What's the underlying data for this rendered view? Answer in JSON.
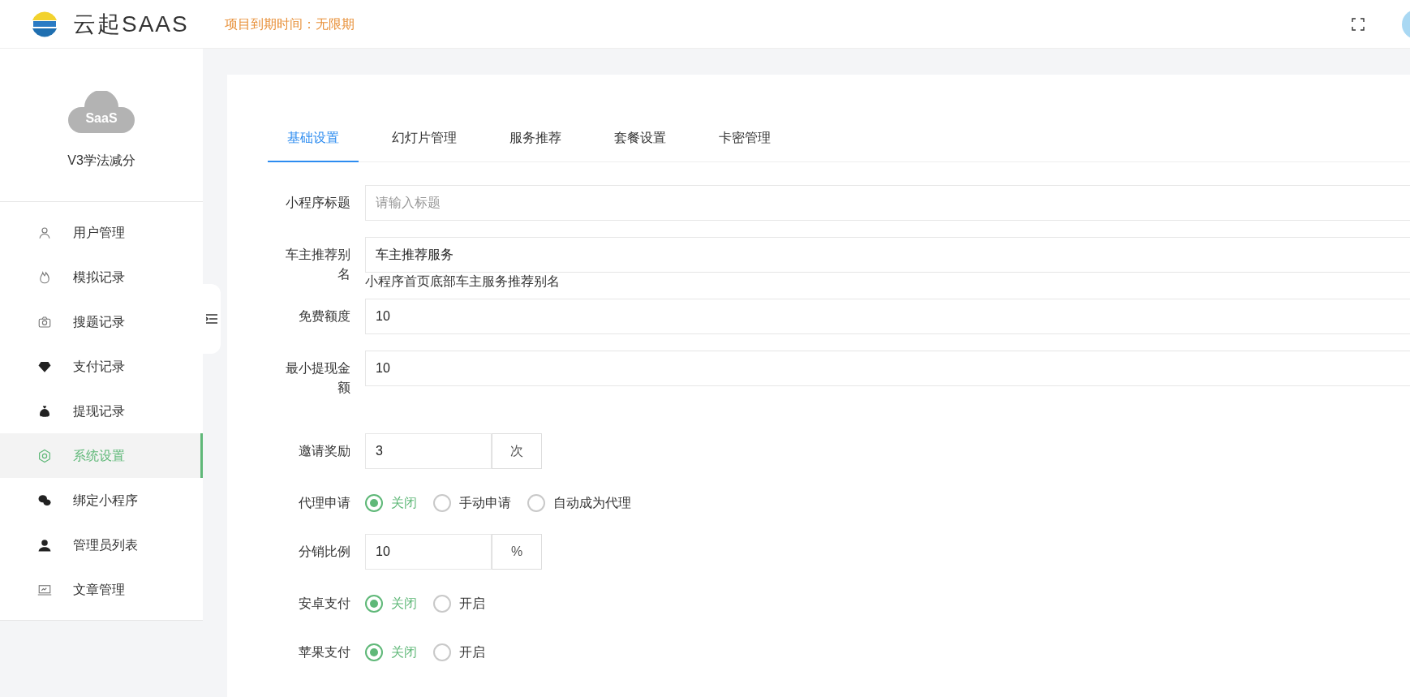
{
  "header": {
    "title": "云起SAAS",
    "expiry": "项目到期时间：无限期"
  },
  "sidebar": {
    "cloud_text": "SaaS",
    "app_name": "V3学法减分",
    "items": [
      {
        "label": "用户管理",
        "selected": false
      },
      {
        "label": "模拟记录",
        "selected": false
      },
      {
        "label": "搜题记录",
        "selected": false
      },
      {
        "label": "支付记录",
        "selected": false
      },
      {
        "label": "提现记录",
        "selected": false
      },
      {
        "label": "系统设置",
        "selected": true
      },
      {
        "label": "绑定小程序",
        "selected": false
      },
      {
        "label": "管理员列表",
        "selected": false
      },
      {
        "label": "文章管理",
        "selected": false
      }
    ]
  },
  "tabs": [
    {
      "label": "基础设置",
      "selected": true
    },
    {
      "label": "幻灯片管理",
      "selected": false
    },
    {
      "label": "服务推荐",
      "selected": false
    },
    {
      "label": "套餐设置",
      "selected": false
    },
    {
      "label": "卡密管理",
      "selected": false
    }
  ],
  "form": {
    "fields": [
      {
        "kind": "text",
        "label": "小程序标题",
        "placeholder": "请输入标题"
      },
      {
        "kind": "text",
        "label": "车主推荐别名",
        "value": "车主推荐服务",
        "help": "小程序首页底部车主服务推荐别名"
      },
      {
        "kind": "text",
        "label": "免费额度",
        "value": "10"
      },
      {
        "kind": "text",
        "label": "最小提现金额",
        "value": "10"
      },
      {
        "kind": "addon",
        "label": "邀请奖励",
        "value": "3",
        "suffix": "次"
      },
      {
        "kind": "radio",
        "label": "代理申请",
        "options": [
          {
            "label": "关闭",
            "selected": true
          },
          {
            "label": "手动申请",
            "selected": false
          },
          {
            "label": "自动成为代理",
            "selected": false
          }
        ]
      },
      {
        "kind": "addon",
        "label": "分销比例",
        "value": "10",
        "suffix": "%"
      },
      {
        "kind": "radio",
        "label": "安卓支付",
        "options": [
          {
            "label": "关闭",
            "selected": true
          },
          {
            "label": "开启",
            "selected": false
          }
        ]
      },
      {
        "kind": "radio",
        "label": "苹果支付",
        "options": [
          {
            "label": "关闭",
            "selected": true
          },
          {
            "label": "开启",
            "selected": false
          }
        ]
      }
    ]
  }
}
